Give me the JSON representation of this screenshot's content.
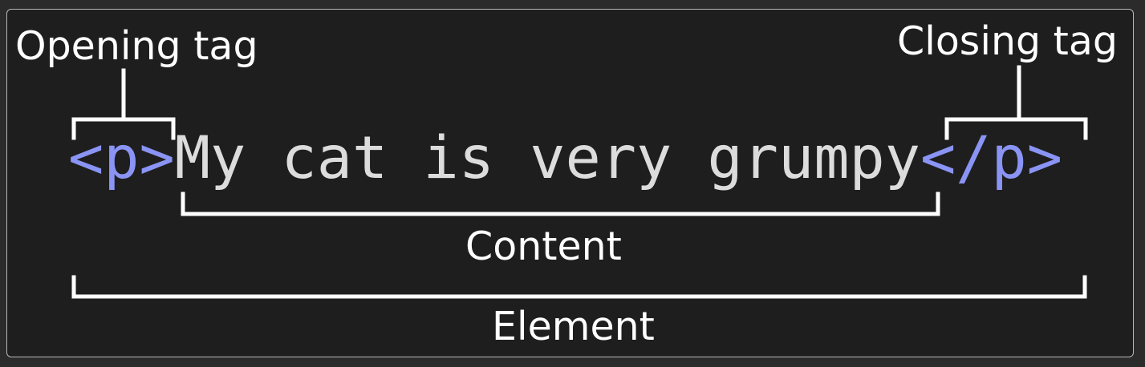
{
  "labels": {
    "opening_tag": "Opening tag",
    "closing_tag": "Closing tag",
    "content": "Content",
    "element": "Element"
  },
  "code": {
    "open_tag": "<p>",
    "content": "My cat is very grumpy",
    "close_tag": "</p>"
  },
  "colors": {
    "background": "#1f1e1e",
    "tag": "#8a94f5",
    "content_text": "#dcdcdc",
    "annotation": "#ffffff"
  }
}
